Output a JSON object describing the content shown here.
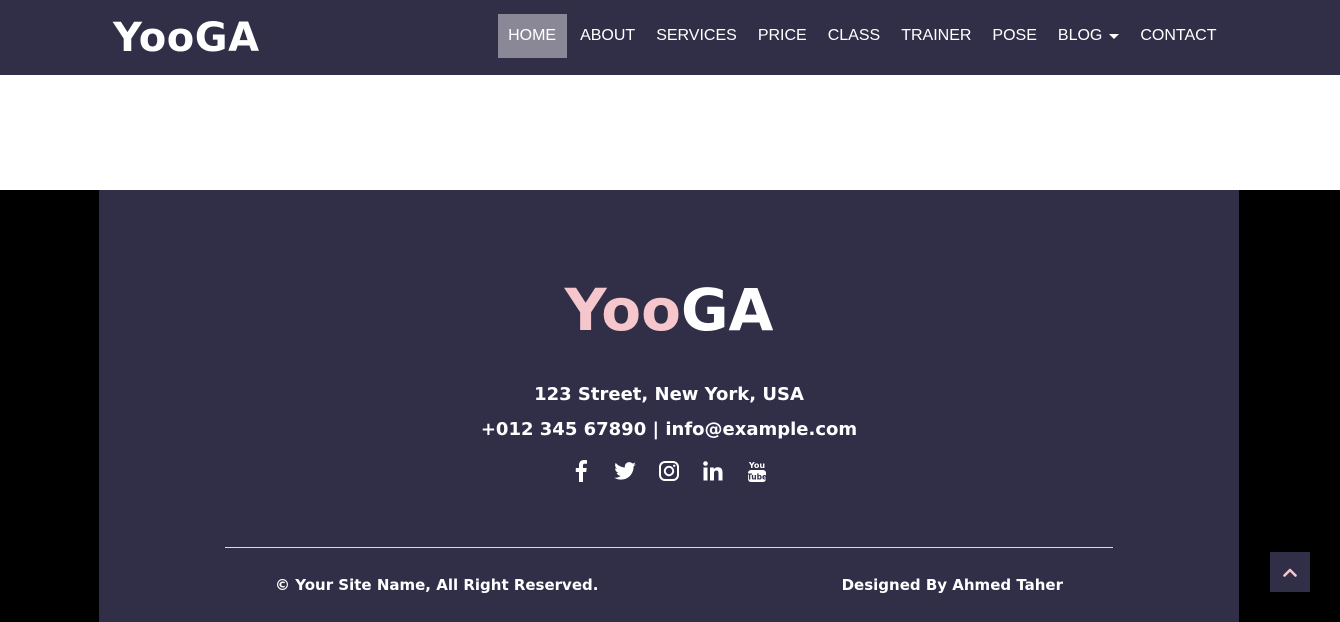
{
  "navbar": {
    "brand": "YooGA",
    "items": [
      {
        "label": "HOME",
        "active": true
      },
      {
        "label": "ABOUT"
      },
      {
        "label": "SERVICES"
      },
      {
        "label": "PRICE"
      },
      {
        "label": "CLASS"
      },
      {
        "label": "TRAINER"
      },
      {
        "label": "POSE"
      },
      {
        "label": "BLOG",
        "dropdown": true
      },
      {
        "label": "CONTACT"
      }
    ]
  },
  "footer": {
    "logo_part1": "Yoo",
    "logo_part2": "GA",
    "address": "123 Street, New York, USA",
    "contact": "+012 345 67890 | info@example.com",
    "socials": [
      "facebook-icon",
      "twitter-icon",
      "instagram-icon",
      "linkedin-icon",
      "youtube-icon"
    ],
    "copyright": "© Your Site Name, All Right Reserved.",
    "designed_by": "Designed By Ahmed Taher"
  },
  "colors": {
    "navbar_bg": "#312e48",
    "accent_pink": "#f5c6cb",
    "active_nav_bg": "#8a8897"
  }
}
